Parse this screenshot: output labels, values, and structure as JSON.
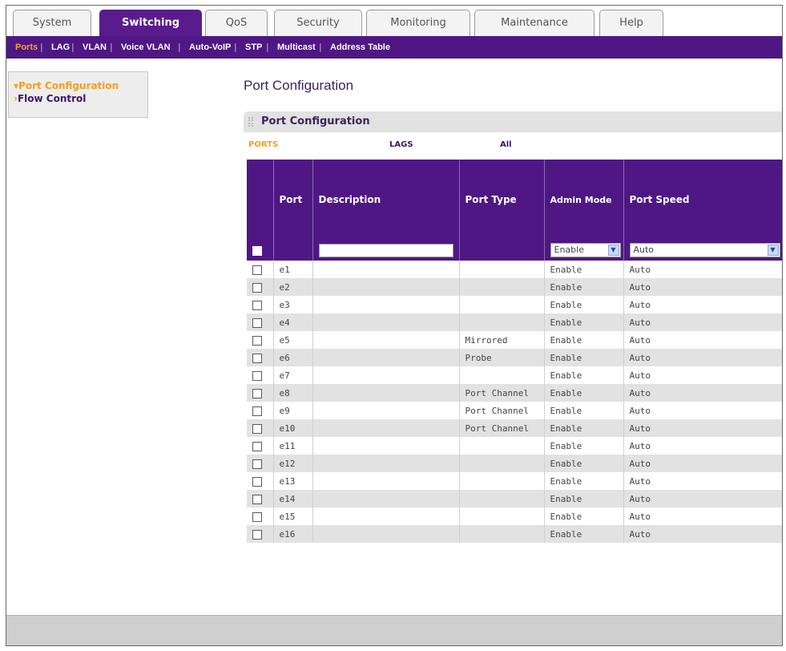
{
  "tabs": [
    "System",
    "Switching",
    "QoS",
    "Security",
    "Monitoring",
    "Maintenance",
    "Help"
  ],
  "active_tab": "Switching",
  "subnav": [
    "Ports",
    "LAG",
    "VLAN",
    "Voice VLAN",
    "Auto-VoIP",
    "STP",
    "Multicast",
    "Address Table"
  ],
  "subnav_active": "Ports",
  "left_menu": {
    "active": "Port Configuration",
    "other": "Flow Control"
  },
  "page_title": "Port Configuration",
  "section_title": "Port Configuration",
  "filters": {
    "ports": "PORTS",
    "lags": "LAGS",
    "all": "All"
  },
  "table": {
    "headers": {
      "port": "Port",
      "description": "Description",
      "port_type": "Port Type",
      "admin_mode": "Admin Mode",
      "port_speed": "Port Speed"
    },
    "edit_row": {
      "admin_mode": "Enable",
      "port_speed": "Auto"
    },
    "rows": [
      {
        "port": "e1",
        "type": "",
        "admin": "Enable",
        "speed": "Auto"
      },
      {
        "port": "e2",
        "type": "",
        "admin": "Enable",
        "speed": "Auto"
      },
      {
        "port": "e3",
        "type": "",
        "admin": "Enable",
        "speed": "Auto"
      },
      {
        "port": "e4",
        "type": "",
        "admin": "Enable",
        "speed": "Auto"
      },
      {
        "port": "e5",
        "type": "Mirrored",
        "admin": "Enable",
        "speed": "Auto"
      },
      {
        "port": "e6",
        "type": "Probe",
        "admin": "Enable",
        "speed": "Auto"
      },
      {
        "port": "e7",
        "type": "",
        "admin": "Enable",
        "speed": "Auto"
      },
      {
        "port": "e8",
        "type": "Port Channel",
        "admin": "Enable",
        "speed": "Auto"
      },
      {
        "port": "e9",
        "type": "Port Channel",
        "admin": "Enable",
        "speed": "Auto"
      },
      {
        "port": "e10",
        "type": "Port Channel",
        "admin": "Enable",
        "speed": "Auto"
      },
      {
        "port": "e11",
        "type": "",
        "admin": "Enable",
        "speed": "Auto"
      },
      {
        "port": "e12",
        "type": "",
        "admin": "Enable",
        "speed": "Auto"
      },
      {
        "port": "e13",
        "type": "",
        "admin": "Enable",
        "speed": "Auto"
      },
      {
        "port": "e14",
        "type": "",
        "admin": "Enable",
        "speed": "Auto"
      },
      {
        "port": "e15",
        "type": "",
        "admin": "Enable",
        "speed": "Auto"
      },
      {
        "port": "e16",
        "type": "",
        "admin": "Enable",
        "speed": "Auto"
      }
    ]
  },
  "colors": {
    "brand_purple": "#4f1784",
    "active_orange": "#f0a020",
    "row_alt": "#e2e2e2"
  }
}
